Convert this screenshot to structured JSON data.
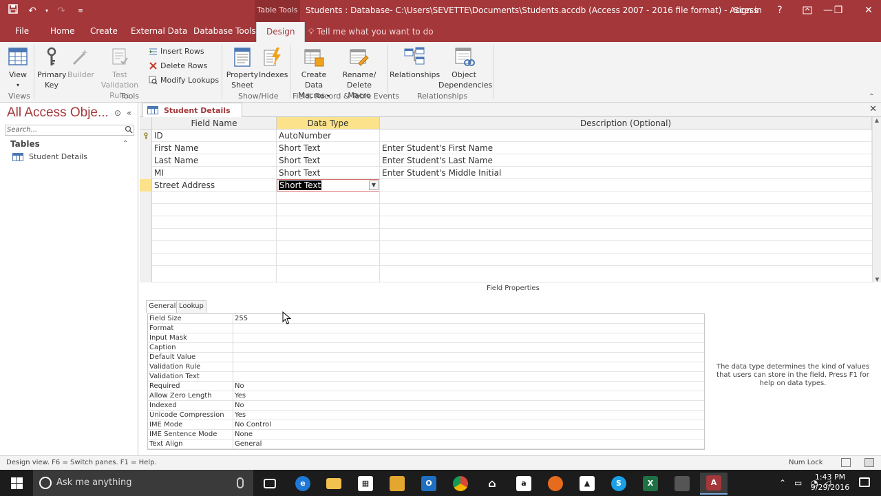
{
  "window": {
    "title": "Students : Database- C:\\Users\\SEVETTE\\Documents\\Students.accdb (Access 2007 - 2016 file format) - Access",
    "tool_context": "Table Tools",
    "sign_in": "Sign in",
    "help": "?",
    "minimize": "—",
    "restore": "❐",
    "close": "✕"
  },
  "ribbon_tabs": {
    "file": "File",
    "home": "Home",
    "create": "Create",
    "external_data": "External Data",
    "database_tools": "Database Tools",
    "design": "Design",
    "tell_me": "Tell me what you want to do"
  },
  "ribbon": {
    "view": "View",
    "primary_key": [
      "Primary",
      "Key"
    ],
    "builder": "Builder",
    "test_validation": [
      "Test Validation",
      "Rules"
    ],
    "insert_rows": "Insert Rows",
    "delete_rows": "Delete Rows",
    "modify_lookups": "Modify Lookups",
    "property_sheet": [
      "Property",
      "Sheet"
    ],
    "indexes": "Indexes",
    "create_data_macros": [
      "Create Data",
      "Macros"
    ],
    "rename_delete_macro": [
      "Rename/",
      "Delete Macro"
    ],
    "relationships": "Relationships",
    "object_dependencies": [
      "Object",
      "Dependencies"
    ],
    "groups": {
      "views": "Views",
      "tools": "Tools",
      "show_hide": "Show/Hide",
      "events": "Field, Record & Table Events",
      "relationships": "Relationships"
    }
  },
  "nav": {
    "title": "All Access Obje...",
    "search_placeholder": "Search...",
    "section": "Tables",
    "items": [
      {
        "label": "Student Details"
      }
    ]
  },
  "document": {
    "tab": "Student Details",
    "columns": {
      "field_name": "Field Name",
      "data_type": "Data Type",
      "description": "Description (Optional)"
    },
    "rows": [
      {
        "field": "ID",
        "type": "AutoNumber",
        "desc": ""
      },
      {
        "field": "First Name",
        "type": "Short Text",
        "desc": "Enter Student's First Name"
      },
      {
        "field": "Last Name",
        "type": "Short Text",
        "desc": "Enter Student's Last Name"
      },
      {
        "field": "MI",
        "type": "Short Text",
        "desc": "Enter Student's Middle Initial"
      },
      {
        "field": "Street Address",
        "type": "Short Text",
        "desc": ""
      }
    ]
  },
  "field_properties": {
    "title": "Field Properties",
    "tabs": [
      "General",
      "Lookup"
    ],
    "rows": [
      {
        "name": "Field Size",
        "value": "255"
      },
      {
        "name": "Format",
        "value": ""
      },
      {
        "name": "Input Mask",
        "value": ""
      },
      {
        "name": "Caption",
        "value": ""
      },
      {
        "name": "Default Value",
        "value": ""
      },
      {
        "name": "Validation Rule",
        "value": ""
      },
      {
        "name": "Validation Text",
        "value": ""
      },
      {
        "name": "Required",
        "value": "No"
      },
      {
        "name": "Allow Zero Length",
        "value": "Yes"
      },
      {
        "name": "Indexed",
        "value": "No"
      },
      {
        "name": "Unicode Compression",
        "value": "Yes"
      },
      {
        "name": "IME Mode",
        "value": "No Control"
      },
      {
        "name": "IME Sentence Mode",
        "value": "None"
      },
      {
        "name": "Text Align",
        "value": "General"
      }
    ],
    "help": "The data type determines the kind of values that users can store in the field. Press F1 for help on data types."
  },
  "status": {
    "text": "Design view.  F6 = Switch panes.  F1 = Help.",
    "num_lock": "Num Lock"
  },
  "taskbar": {
    "search": "Ask me anything",
    "time": "1:43 PM",
    "date": "9/29/2016"
  },
  "colors": {
    "access_red": "#a4373a",
    "selection_yellow": "#fce28a"
  }
}
